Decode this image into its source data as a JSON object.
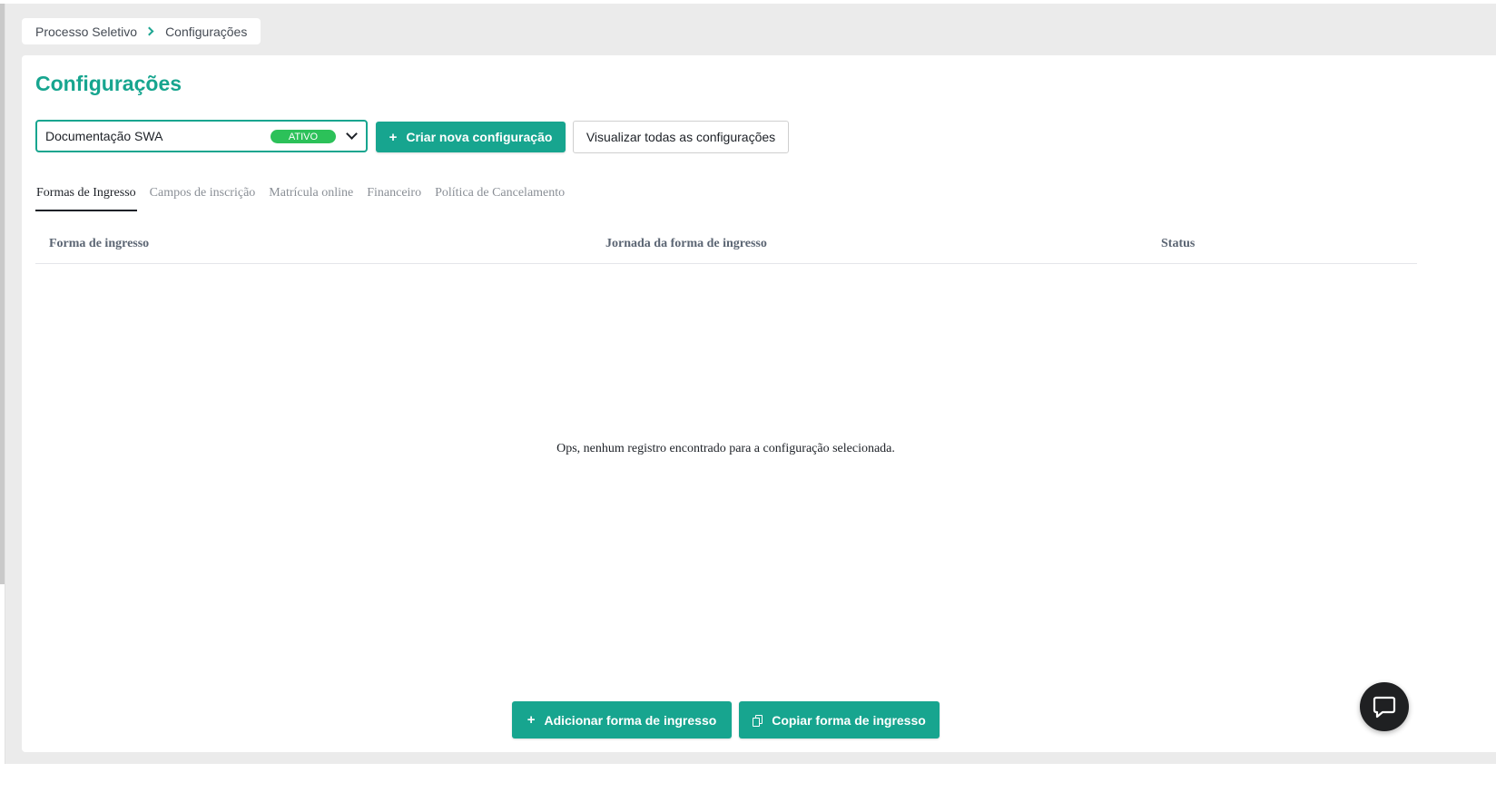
{
  "breadcrumb": {
    "items": [
      "Processo Seletivo",
      "Configurações"
    ]
  },
  "page": {
    "title": "Configurações"
  },
  "config_select": {
    "value": "Documentação SWA",
    "badge": "ATIVO"
  },
  "toolbar": {
    "create_label": "Criar nova configuração",
    "view_all_label": "Visualizar todas as configurações"
  },
  "tabs": [
    {
      "label": "Formas de Ingresso",
      "active": true
    },
    {
      "label": "Campos de inscrição",
      "active": false
    },
    {
      "label": "Matrícula online",
      "active": false
    },
    {
      "label": "Financeiro",
      "active": false
    },
    {
      "label": "Política de Cancelamento",
      "active": false
    }
  ],
  "table": {
    "columns": [
      "Forma de ingresso",
      "Jornada da forma de ingresso",
      "Status"
    ],
    "rows": [],
    "empty_message": "Ops, nenhum registro encontrado para a configuração selecionada."
  },
  "actions": {
    "add_label": "Adicionar forma de ingresso",
    "copy_label": "Copiar forma de ingresso"
  },
  "colors": {
    "accent": "#17a58f",
    "badge_active": "#2cc159",
    "chat_button": "#1f2022"
  },
  "icons": {
    "breadcrumb_separator": "chevron-right-icon",
    "select_toggle": "chevron-down-icon",
    "create": "plus-icon",
    "copy": "copy-icon",
    "chat": "chat-bubble-icon"
  }
}
